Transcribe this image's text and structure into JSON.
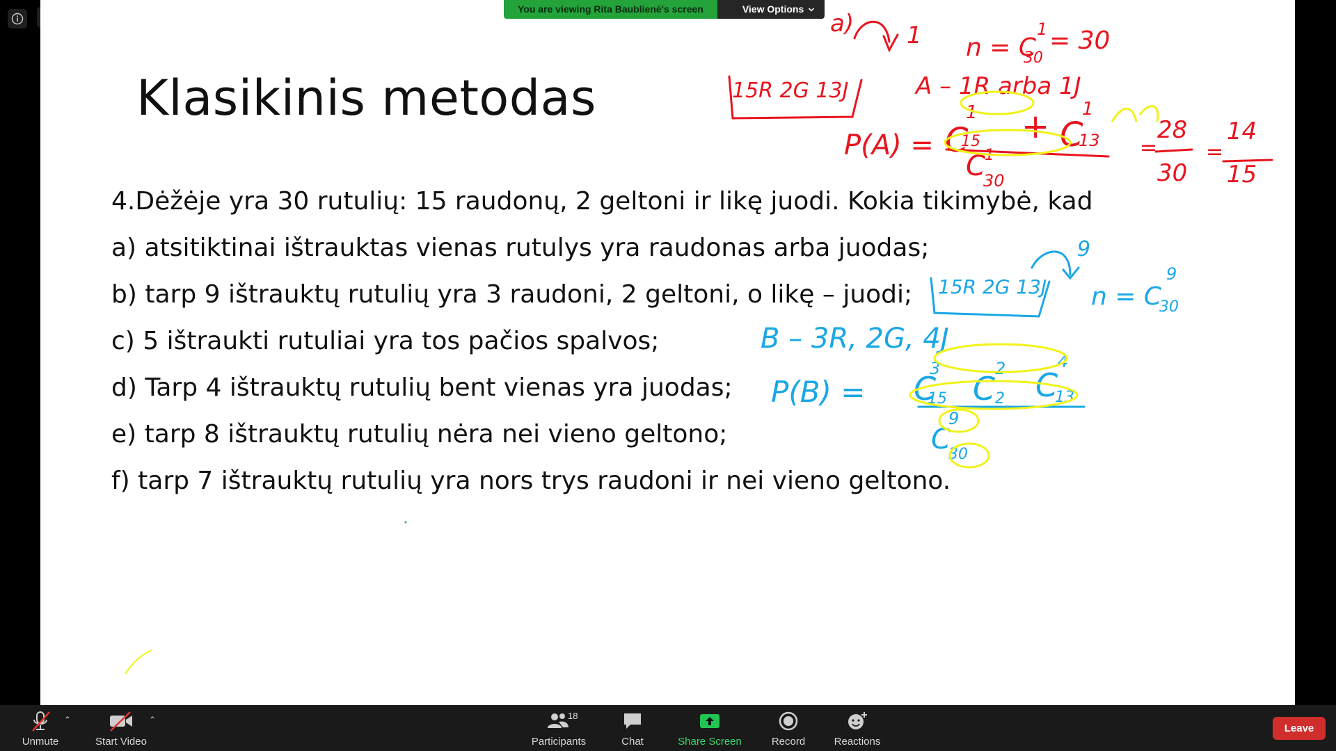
{
  "banner": {
    "status_text": "You are viewing Rita Baublienė's screen",
    "view_options_label": "View Options"
  },
  "slide": {
    "title": "Klasikinis metodas",
    "lines": [
      "4.Dėžėje yra 30 rutulių: 15 raudonų, 2 geltoni ir likę juodi. Kokia tikimybė, kad",
      "a) atsitiktinai ištrauktas vienas rutulys yra raudonas arba juodas;",
      "b) tarp 9 ištrauktų rutulių yra 3 raudoni, 2 geltoni, o likę – juodi;",
      "c) 5 ištraukti rutuliai yra tos pačios spalvos;",
      "d) Tarp 4 ištrauktų rutulių bent vienas yra juodas;",
      "e) tarp 8 ištrauktų rutulių nėra nei vieno geltono;",
      "f) tarp 7 ištrauktų rutulių yra nors trys raudoni ir nei vieno geltono."
    ]
  },
  "annotations": {
    "red": {
      "part_label": "a)",
      "draw_count": "1",
      "n_formula": "n = C",
      "n_sup": "1",
      "n_sub": "30",
      "n_value": "= 30",
      "box_text": "15R 2G 13J",
      "event_text": "A – 1R arba 1J",
      "pa_label": "P(A) =",
      "c1_sup": "1",
      "c1_sub": "15",
      "plus": "+",
      "c2_sup": "1",
      "c2_sub": "13",
      "den_sup": "1",
      "den_sub": "30",
      "eq1": "=",
      "frac1_num": "28",
      "frac1_den": "30",
      "eq2": "=",
      "frac2_num": "14",
      "frac2_den": "15"
    },
    "blue": {
      "draw_count": "9",
      "box_text": "15R 2G 13J",
      "n_formula": "n = C",
      "n_sup": "9",
      "n_sub": "30",
      "event_text": "B – 3R, 2G, 4J",
      "pb_label": "P(B) =",
      "c1_sup": "3",
      "c1_sub": "15",
      "c2_sup": "2",
      "c2_sub": "2",
      "c3_sup": "4",
      "c3_sub": "13",
      "den_sup": "9",
      "den_sub": "30"
    },
    "colors": {
      "red": "#e8141e",
      "blue": "#1aa7e6",
      "yellow": "#f2f21a"
    }
  },
  "toolbar": {
    "unmute_label": "Unmute",
    "start_video_label": "Start Video",
    "participants_label": "Participants",
    "participants_count": "18",
    "chat_label": "Chat",
    "share_label": "Share Screen",
    "record_label": "Record",
    "reactions_label": "Reactions",
    "leave_label": "Leave"
  }
}
